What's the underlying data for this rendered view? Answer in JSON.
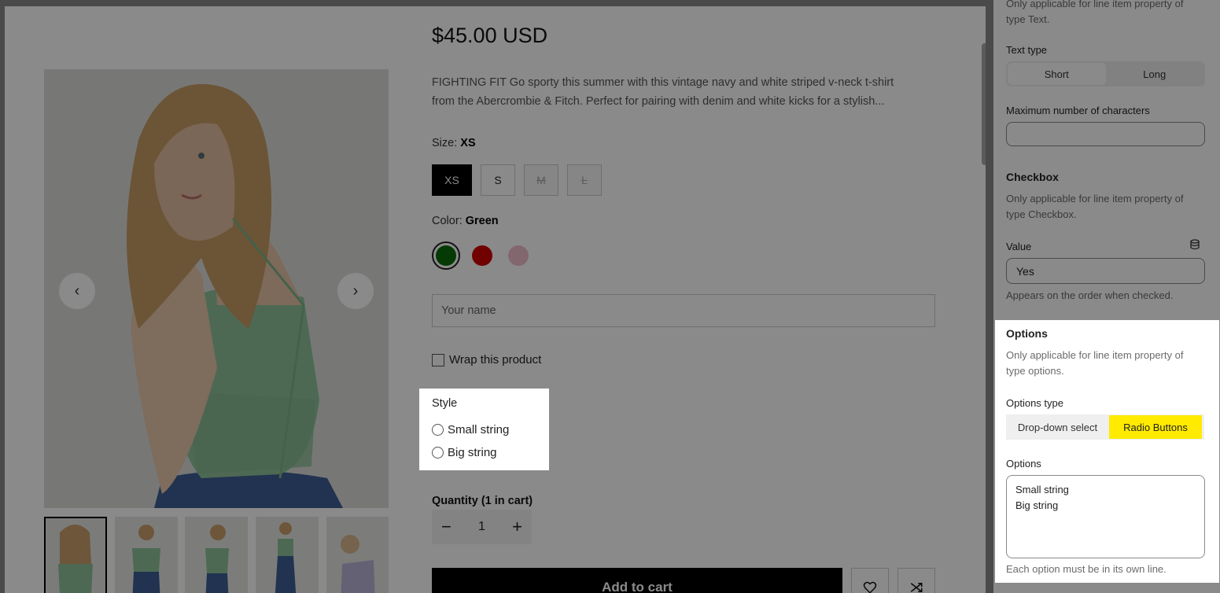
{
  "product": {
    "price": "$45.00 USD",
    "description_line1": "FIGHTING FIT Go sporty this summer with this vintage navy and white striped v-neck t-shirt",
    "description_line2": "from the Abercrombie & Fitch. Perfect for pairing with denim and white kicks for a stylish...",
    "size_label": "Size:",
    "size_value": "XS",
    "sizes": [
      "XS",
      "S",
      "M",
      "L"
    ],
    "color_label": "Color:",
    "color_value": "Green",
    "colors": [
      "#0b6b0b",
      "#d10000",
      "#f2bfcb"
    ],
    "name_placeholder": "Your name",
    "wrap_label": "Wrap this product",
    "style_title": "Style",
    "style_options": [
      "Small string",
      "Big string"
    ],
    "quantity_label": "Quantity (1 in cart)",
    "quantity_value": "1",
    "qty_minus": "−",
    "qty_plus": "+",
    "add_to_cart": "Add to cart",
    "prev_icon": "‹",
    "next_icon": "›"
  },
  "sidebar": {
    "text_help_line1": "Only applicable for line item property of",
    "text_help_line2": "type Text.",
    "text_type_label": "Text type",
    "text_type_options": [
      "Short",
      "Long"
    ],
    "max_chars_label": "Maximum number of characters",
    "max_chars_value": "",
    "checkbox_heading": "Checkbox",
    "checkbox_help_line1": "Only applicable for line item property of",
    "checkbox_help_line2": "type Checkbox.",
    "value_label": "Value",
    "value_value": "Yes",
    "value_help": "Appears on the order when checked.",
    "options_heading": "Options",
    "options_help_line1": "Only applicable for line item property of",
    "options_help_line2": "type options.",
    "options_type_label": "Options type",
    "options_type_choices": [
      "Drop-down select",
      "Radio Buttons"
    ],
    "options_label": "Options",
    "options_lines": [
      "Small string",
      "Big string"
    ],
    "options_help": "Each option must be in its own line."
  },
  "colors": {
    "highlight": "#ffeb00",
    "accent": "#000000"
  }
}
